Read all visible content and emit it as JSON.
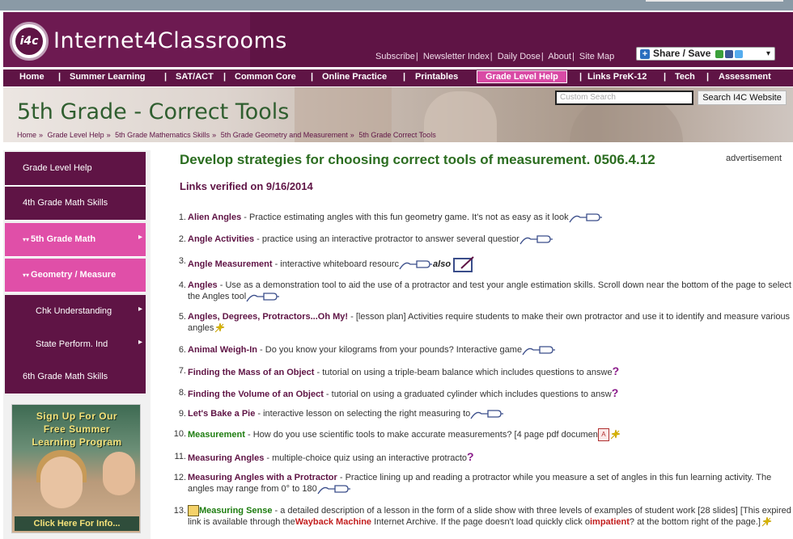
{
  "site": {
    "logo_text": "i4c",
    "title": "Internet4Classrooms"
  },
  "toplinks": [
    "Subscribe",
    "Newsletter Index",
    "Daily Dose",
    "About",
    "Site Map"
  ],
  "share": {
    "label": "Share / Save"
  },
  "nav": [
    "Home",
    "Summer Learning",
    "SAT/ACT",
    "Common Core",
    "Online Practice",
    "Printables",
    "Grade Level Help",
    "Links PreK-12",
    "Tech",
    "Assessment"
  ],
  "banner": {
    "title": "5th Grade - Correct Tools",
    "breadcrumbs": [
      "Home",
      "Grade Level Help",
      "5th Grade Mathematics Skills",
      "5th Grade Geometry and Measurement",
      "5th Grade Correct Tools"
    ],
    "search_placeholder": "Custom Search",
    "search_button": "Search I4C Website"
  },
  "sidebar": {
    "items": [
      "Grade Level Help",
      "4th Grade Math Skills",
      "5th Grade Math",
      "Geometry / Measure",
      "Chk Understanding",
      "State Perform. Ind",
      "6th Grade Math Skills"
    ],
    "promo": {
      "line1": "Sign Up For Our",
      "line2": "Free Summer",
      "line3": "Learning Program",
      "cta": "Click Here For Info..."
    }
  },
  "main": {
    "title": "Develop strategies for choosing correct tools of measurement. 0506.4.12",
    "advertisement": "advertisement",
    "verified": "Links verified on 9/16/2014",
    "links": [
      {
        "num": "1.",
        "title": "Alien Angles",
        "desc": " - Practice estimating angles with this fun geometry game. It's not as easy as it look"
      },
      {
        "num": "2.",
        "title": "Angle Activities",
        "desc": " - practice using an interactive protractor to answer several questior"
      },
      {
        "num": "3.",
        "title": "Angle Measurement",
        "desc": "  - interactive whiteboard resourc",
        "also": "also"
      },
      {
        "num": "4.",
        "title": "Angles",
        "desc": "  - Use as a demonstration tool to aid the use of a protractor and test your angle estimation skills. Scroll down near the bottom of the page to select the Angles tool"
      },
      {
        "num": "5.",
        "title": "Angles, Degrees, Protractors...Oh My!",
        "desc": " - [lesson plan] Activities require students to make their own protractor and use it to identify and measure various angles"
      },
      {
        "num": "6.",
        "title": "Animal Weigh-In",
        "desc": "  - Do you know your kilograms from your pounds? Interactive game"
      },
      {
        "num": "7.",
        "title": "Finding the Mass of an Object",
        "desc": "   - tutorial on using a triple-beam balance which includes questions to answe"
      },
      {
        "num": "8.",
        "title": "Finding the Volume of an Object",
        "desc": "   - tutorial on using a graduated cylinder which includes questions to answ"
      },
      {
        "num": "9.",
        "title": "Let's Bake a Pie",
        "desc": " - interactive lesson on selecting the right measuring to"
      },
      {
        "num": "10.",
        "title": "Measurement",
        "desc": "  - How do you use scientific tools to make accurate measurements? [4 page  pdf documen"
      },
      {
        "num": "11.",
        "title": "Measuring Angles",
        "desc": "  - multiple-choice quiz using an interactive protracto"
      },
      {
        "num": "12.",
        "title": "Measuring Angles with a Protractor",
        "desc": "   - Practice lining up and reading a protractor while you measure a set of angles in this fun learning activity. The angles may range from 0° to 180"
      },
      {
        "num": "13.",
        "title": "Measuring Sense",
        "desc1": "  - a detailed description of a lesson in the form of a slide show with three levels of examples of student work [28 slides] [This expired link is available through the",
        "wayback": "Wayback Machine",
        "desc2": " Internet Archive. If the page doesn't load quickly click o",
        "impatient": "impatient",
        "desc3": "?  at the bottom right of the page.]"
      }
    ]
  }
}
